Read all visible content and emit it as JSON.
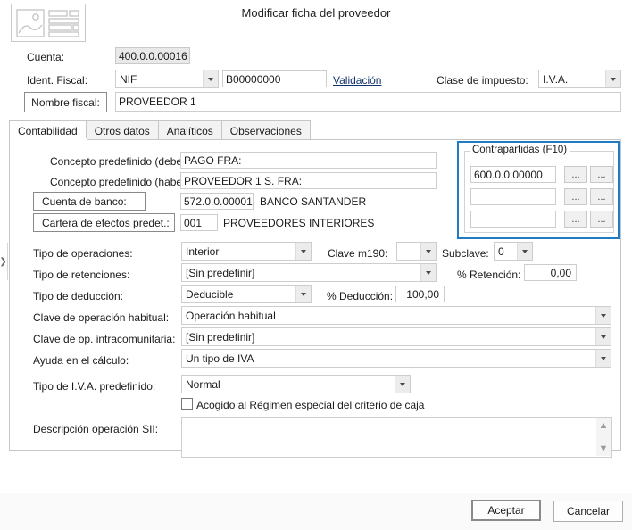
{
  "dialog": {
    "title": "Modificar ficha del proveedor",
    "icon": "form-image-placeholder-icon"
  },
  "header": {
    "cuenta_label": "Cuenta:",
    "cuenta_value": "400.0.0.00016",
    "ident_fiscal_label": "Ident. Fiscal:",
    "ident_fiscal_type": "NIF",
    "ident_fiscal_number": "B00000000",
    "validacion_link": "Validación",
    "clase_impuesto_label": "Clase de impuesto:",
    "clase_impuesto_value": "I.V.A.",
    "nombre_fiscal_label": "Nombre fiscal:",
    "nombre_fiscal_value": "PROVEEDOR 1"
  },
  "tabs": [
    {
      "label": "Contabilidad",
      "active": true
    },
    {
      "label": "Otros datos",
      "active": false
    },
    {
      "label": "Analíticos",
      "active": false
    },
    {
      "label": "Observaciones",
      "active": false
    }
  ],
  "form": {
    "concepto_debe_label": "Concepto predefinido (debe):",
    "concepto_debe_value": "PAGO FRA:",
    "concepto_haber_label": "Concepto predefinido (haber):",
    "concepto_haber_value": " PROVEEDOR 1 S. FRA:",
    "cuenta_banco_label": "Cuenta de banco:",
    "cuenta_banco_code": "572.0.0.00001",
    "cuenta_banco_name": "BANCO SANTANDER",
    "cartera_label": "Cartera de efectos predet.:",
    "cartera_code": "001",
    "cartera_name": "PROVEEDORES INTERIORES",
    "tipo_operaciones_label": "Tipo de operaciones:",
    "tipo_operaciones_value": "Interior",
    "clave_m190_label": "Clave m190:",
    "clave_m190_value": "",
    "subclave_label": "Subclave:",
    "subclave_value": "0",
    "tipo_retenciones_label": "Tipo de retenciones:",
    "tipo_retenciones_value": "[Sin predefinir]",
    "pct_retencion_label": "% Retención:",
    "pct_retencion_value": "0,00",
    "tipo_deduccion_label": "Tipo de deducción:",
    "tipo_deduccion_value": "Deducible",
    "pct_deduccion_label": "% Deducción:",
    "pct_deduccion_value": "100,00",
    "clave_op_habitual_label": "Clave de operación habitual:",
    "clave_op_habitual_value": "Operación habitual",
    "clave_op_intra_label": "Clave de op. intracomunitaria:",
    "clave_op_intra_value": "[Sin predefinir]",
    "ayuda_calculo_label": "Ayuda en el cálculo:",
    "ayuda_calculo_value": "Un tipo de IVA",
    "tipo_iva_label": "Tipo de I.V.A. predefinido:",
    "tipo_iva_value": "Normal",
    "criterio_caja_label": "Acogido al Régimen especial del criterio de caja",
    "criterio_caja_checked": false,
    "descripcion_sii_label": "Descripción operación SII:",
    "descripcion_sii_value": ""
  },
  "contrapartidas": {
    "legend": "Contrapartidas (F10)",
    "highlight_color": "#1e7bc4",
    "rows": [
      {
        "value": "600.0.0.00000",
        "btn1": "...",
        "btn2": "..."
      },
      {
        "value": "",
        "btn1": "...",
        "btn2": "..."
      },
      {
        "value": "",
        "btn1": "...",
        "btn2": "..."
      }
    ]
  },
  "footer": {
    "accept_label": "Aceptar",
    "cancel_label": "Cancelar"
  }
}
